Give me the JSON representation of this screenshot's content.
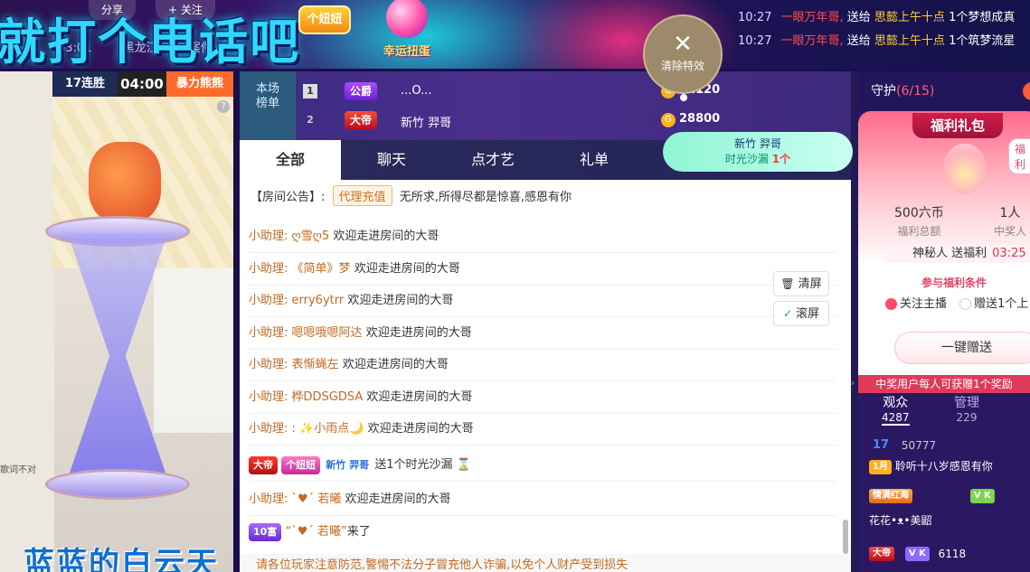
{
  "header": {
    "title_banner": "就打个电话吧",
    "share_label": "分享",
    "follow_label": "关注",
    "time": "03:01",
    "meta_a": "黑龙江",
    "meta_b": "案件",
    "girl_badge": "个妞妞",
    "lucky_label": "幸运扭蛋",
    "ticker": [
      {
        "time": "10:27",
        "user": "一眼万年哥,",
        "verb": "送给",
        "target": "思懿上午十点",
        "gift": "1个梦想成真"
      },
      {
        "time": "10:27",
        "user": "一眼万年哥,",
        "verb": "送给",
        "target": "思懿上午十点",
        "gift": "1个筑梦流星"
      }
    ],
    "clear_effect_label": "清除特效"
  },
  "stage": {
    "pk_streak": "17连胜",
    "pk_timer": "04:00",
    "pk_team": "暴力熊熊",
    "help": "?",
    "caption": "蓝蓝的白云天",
    "small_note": "歌词不对"
  },
  "rank": {
    "side_label_1": "本场",
    "side_label_2": "榜单",
    "rows": [
      {
        "num": "1",
        "level": "公爵",
        "name": "...O...",
        "coin": "G",
        "score": "31120"
      },
      {
        "num": "2",
        "level": "大帝",
        "name": "新竹 羿哥",
        "coin": "G",
        "score": "28800"
      }
    ]
  },
  "hourglass_tip": {
    "users": "新竹 羿哥",
    "text": "时光沙漏",
    "count": "1个"
  },
  "chat": {
    "tabs": [
      "全部",
      "聊天",
      "点才艺",
      "礼单"
    ],
    "notice_prefix": "【房间公告】:",
    "notice_tag": "代理充值",
    "notice_text": "无所求,所得尽都是惊喜,感恩有你",
    "messages": [
      {
        "who": "小助理:",
        "nick": "ღ雪ღ5",
        "text": "欢迎走进房间的大哥"
      },
      {
        "who": "小助理:",
        "nick": "《简单》梦",
        "text": "欢迎走进房间的大哥"
      },
      {
        "who": "小助理:",
        "nick": "erry6ytrr",
        "text": "欢迎走进房间的大哥"
      },
      {
        "who": "小助理:",
        "nick": "嗯嗯哦嗯阿达",
        "text": "欢迎走进房间的大哥"
      },
      {
        "who": "小助理:",
        "nick": "表惭蝇左",
        "text": "欢迎走进房间的大哥"
      },
      {
        "who": "小助理:",
        "nick": "桦DDSGDSA",
        "text": "欢迎走进房间的大哥"
      },
      {
        "who": "小助理:",
        "nick": ": ✨小雨点🌙",
        "text": "欢迎走进房间的大哥"
      }
    ],
    "gift_msg": {
      "level": "大帝",
      "badge": "个妞妞",
      "user": "新竹 羿哥",
      "text": "送1个时光沙漏"
    },
    "last_assist": {
      "who": "小助理:",
      "nick": "ˋ♥ˊ 若曦",
      "text": "欢迎走进房间的大哥"
    },
    "enter_msg": {
      "badge": "10富",
      "nick": "“ˋ♥ˊ 若曦”",
      "text": "来了"
    },
    "clear_btn": "清屏",
    "scroll_btn": "滚屏",
    "warning": "请各位玩家注意防范,警惕不法分子冒充他人诈骗,以免个人财产受到损失"
  },
  "right": {
    "guard_label": "守护",
    "guard_count": "(6/15)",
    "welfare_title": "福利礼包",
    "welfare_tag": "福利",
    "stat1_value": "500六币",
    "stat1_label": "福利总额",
    "stat2_value": "1人",
    "stat2_label": "中奖人",
    "mystery_text": "神秘人 送福利",
    "mystery_time": "03:25",
    "cond_title": "参与福利条件",
    "opt1": "关注主播",
    "opt2": "赠送1个上",
    "send_btn": "一键赠送",
    "note": "中奖用户每人可获赠1个奖励",
    "audience_label": "观众",
    "audience_count": "4287",
    "manage_label": "管理",
    "manage_count": "229",
    "viewers": [
      {
        "badge": "17",
        "score": "50777",
        "tag": "1月",
        "name": "聆听十八岁感恩有你"
      },
      {
        "badge": "情满红海",
        "score": "",
        "tag": "V K",
        "name": "花花•ᴥ•美鼦"
      },
      {
        "badge": "大帝",
        "score": "6118",
        "tag": "V K",
        "name": ""
      }
    ]
  },
  "colors": {
    "accent_cyan": "#2fd8ff",
    "assistant_orange": "#c36a20",
    "ticker_red": "#ff4d4d",
    "ticker_yellow": "#ffcc33",
    "welfare_pink": "#e03a5a"
  }
}
